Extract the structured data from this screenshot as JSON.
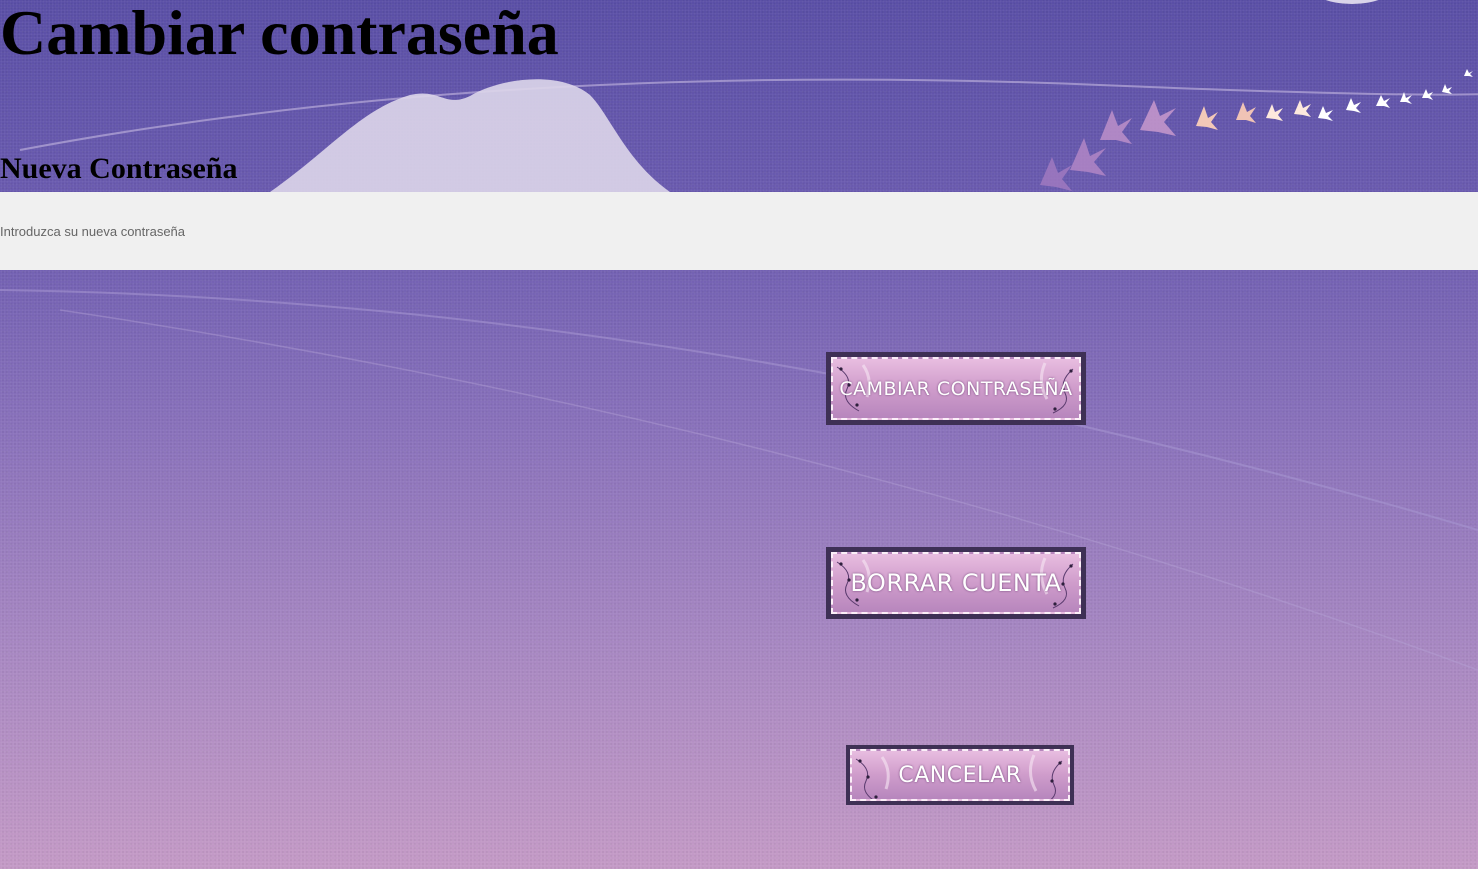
{
  "header": {
    "title": "Cambiar contraseña",
    "subtitle": "Nueva Contraseña"
  },
  "password_field": {
    "placeholder": "Introduzca su nueva contraseña",
    "value": ""
  },
  "buttons": {
    "change_password": "CAMBIAR CONTRASEÑA",
    "delete_account": "BORRAR CUENTA",
    "cancel": "CANCELAR"
  },
  "colors": {
    "background_top": "#5a4fa6",
    "background_bottom": "#c49ac6",
    "input_background": "#f0f0f0",
    "button_border": "#3e3055",
    "button_fill": "#cf9ccb"
  }
}
